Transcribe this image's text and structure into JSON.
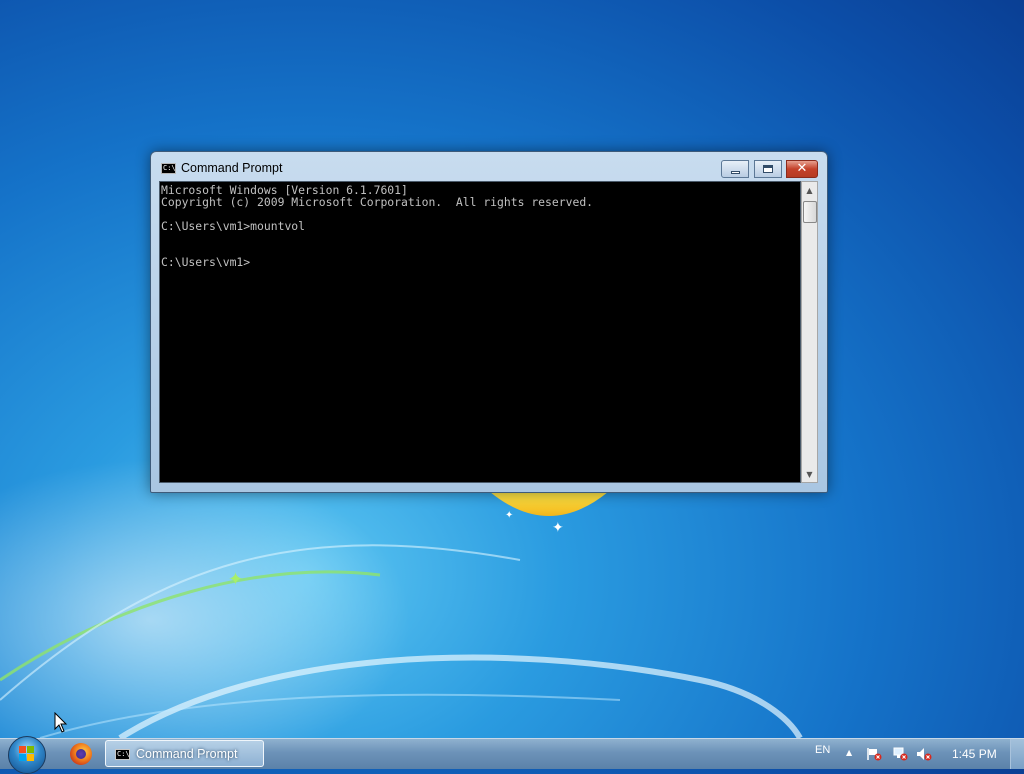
{
  "window": {
    "title": "Command Prompt",
    "console_lines": [
      "Microsoft Windows [Version 6.1.7601]",
      "Copyright (c) 2009 Microsoft Corporation.  All rights reserved.",
      "",
      "C:\\Users\\vm1>mountvol",
      "",
      "",
      "C:\\Users\\vm1>"
    ]
  },
  "taskbar": {
    "task_label": "Command Prompt",
    "language": "EN",
    "time": "1:45 PM"
  },
  "icons": {
    "start": "windows-start-orb",
    "pinned": [
      "firefox-icon"
    ],
    "tray": [
      "action-center-flag-icon",
      "network-icon",
      "volume-muted-icon"
    ]
  },
  "colors": {
    "console_bg": "#000000",
    "console_fg": "#c0c0c0",
    "desktop": "#1573c9",
    "close_button": "#c4412a"
  }
}
